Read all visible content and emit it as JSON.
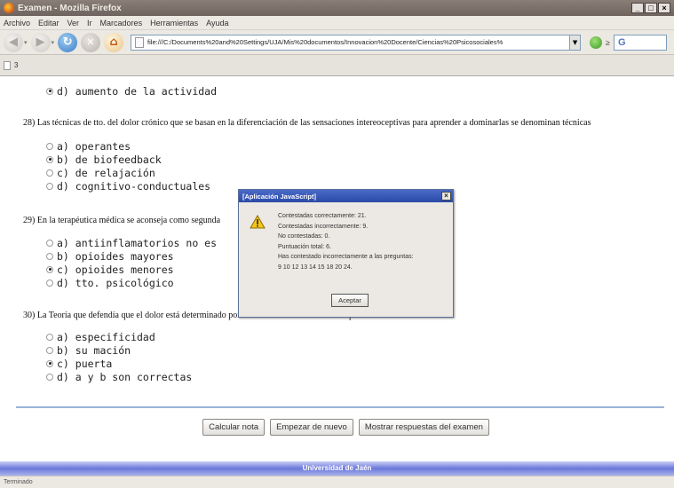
{
  "window": {
    "title": "Examen - Mozilla Firefox",
    "buttons": {
      "minimize": "_",
      "maximize": "□",
      "close": "×"
    }
  },
  "menu": [
    "Archivo",
    "Editar",
    "Ver",
    "Ir",
    "Marcadores",
    "Herramientas",
    "Ayuda"
  ],
  "toolbar": {
    "url": "file:///C:/Documents%20and%20Settings/UJA/Mis%20documentos/Innovacion%20Docente/Ciencias%20Psicosociales%",
    "go_label": "≥",
    "search_text": "G"
  },
  "tab": {
    "label": "3"
  },
  "questions": {
    "q27_option_d": "d) aumento de la actividad",
    "q28": {
      "text": "28) Las técnicas de tto. del dolor crónico que se basan en la diferenciación de las sensaciones intereoceptivas para aprender a dominarlas se denominan técnicas",
      "options": [
        "a) operantes",
        "b) de biofeedback",
        "c) de relajación",
        "d) cognitivo-conductuales"
      ],
      "selected": 1
    },
    "q29": {
      "text": "29) En la terapéutica médica se aconseja como segunda",
      "options": [
        "a) antiinflamatorios no es",
        "b) opioides mayores",
        "c) opioides menores",
        "d) tto. psicológico"
      ],
      "selected": 2
    },
    "q30": {
      "text": "30) La Teoría que defendía que el dolor está determinado por mecanismos entre l  médula espinal era la teoría de la",
      "options": [
        "a) especificidad",
        "b) su mación",
        "c) puerta",
        "d) a y b son correctas"
      ],
      "selected": 2
    }
  },
  "buttons": {
    "calc": "Calcular nota",
    "restart": "Empezar de nuevo",
    "show": "Mostrar respuestas del examen"
  },
  "footer": {
    "university": "Universidad de Jaén",
    "status": "Terminado"
  },
  "dialog": {
    "title": "[Aplicación JavaScript]",
    "close": "×",
    "lines": [
      "Contestadas correctamente: 21.",
      "Contestadas incorrectamente: 9.",
      "No contestadas: 0.",
      "Puntuación total: 6.",
      "Has contestado incorrectamente a las preguntas:",
      "9 10 12 13 14 15 18 20 24."
    ],
    "button": "Aceptar"
  },
  "colors": {
    "title_bar": "#6e635d",
    "dialog_title": "#2b4aa8",
    "rule": "#9ab4d8",
    "footer_strip": "#6b78d9"
  }
}
